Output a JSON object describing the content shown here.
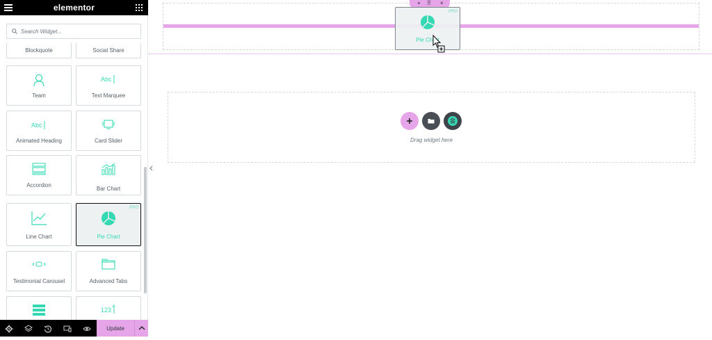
{
  "app": {
    "logo": "elementor"
  },
  "search": {
    "placeholder": "Search Widget..."
  },
  "widgets": [
    {
      "label": "Blockquote",
      "icon": "blockquote-icon"
    },
    {
      "label": "Social Share",
      "icon": "social-share-icon"
    },
    {
      "label": "Team",
      "icon": "team-member-icon"
    },
    {
      "label": "Text Marquee",
      "icon": "text-marquee-icon"
    },
    {
      "label": "Animated Heading",
      "icon": "animated-heading-icon"
    },
    {
      "label": "Card Slider",
      "icon": "card-slider-icon"
    },
    {
      "label": "Accordion",
      "icon": "accordion-icon"
    },
    {
      "label": "Bar Chart",
      "icon": "bar-chart-icon"
    },
    {
      "label": "Line Chart",
      "icon": "line-chart-icon"
    },
    {
      "label": "Pie Chart",
      "icon": "pie-chart-icon",
      "selected": true,
      "badge": "PRO"
    },
    {
      "label": "Testimonial Carousel",
      "icon": "testimonial-carousel-icon"
    },
    {
      "label": "Advanced Tabs",
      "icon": "advanced-tabs-icon"
    },
    {
      "label": "",
      "icon": "list-icon"
    },
    {
      "label": "",
      "icon": "counter-icon",
      "icon_text": "123"
    }
  ],
  "footer": {
    "update_label": "Update"
  },
  "canvas": {
    "handle": {
      "add": "+",
      "move": "⠿",
      "close": "×"
    },
    "drag_ghost": {
      "label": "Pie Chart",
      "badge": "PRO"
    },
    "empty_section": {
      "drag_text": "Drag widget here"
    }
  },
  "colors": {
    "accent": "#e6a5e8",
    "teal": "#34d9b4",
    "dark": "#000000",
    "border": "#d5dadf"
  }
}
